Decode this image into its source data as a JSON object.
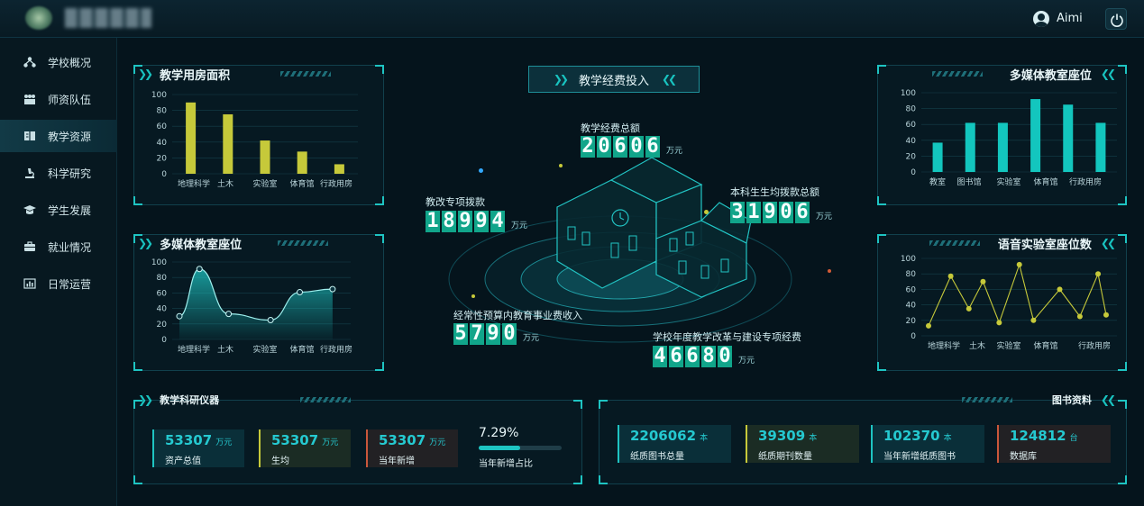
{
  "header": {
    "user_name": "Aimi"
  },
  "sidebar": {
    "items": [
      {
        "label": "学校概况",
        "icon": "network-icon"
      },
      {
        "label": "师资队伍",
        "icon": "people-icon"
      },
      {
        "label": "教学资源",
        "icon": "book-icon",
        "active": true
      },
      {
        "label": "科学研究",
        "icon": "microscope-icon"
      },
      {
        "label": "学生发展",
        "icon": "graduate-icon"
      },
      {
        "label": "就业情况",
        "icon": "briefcase-icon"
      },
      {
        "label": "日常运营",
        "icon": "bar-chart-icon"
      }
    ]
  },
  "colors": {
    "teal": "#1ec4c2",
    "yellow": "#c6c93a",
    "green": "#11a58a"
  },
  "chart_data": [
    {
      "type": "bar",
      "title": "教学用房面积",
      "categories": [
        "地理科学",
        "土木",
        "实验室",
        "体育馆",
        "行政用房"
      ],
      "values": [
        90,
        75,
        42,
        28,
        12
      ],
      "ylim": [
        0,
        100
      ],
      "yticks": [
        "0",
        "20",
        "40",
        "60",
        "80",
        "100"
      ],
      "color": "#c6c93a",
      "grid": true
    },
    {
      "type": "area",
      "title": "多媒体教室座位",
      "categories": [
        "地理科学",
        "土木",
        "实验室",
        "体育馆",
        "行政用房"
      ],
      "x": [
        0,
        0.55,
        1.35,
        2.5,
        3.3,
        4.2
      ],
      "values": [
        30,
        91,
        33,
        25,
        61,
        65
      ],
      "ylim": [
        0,
        100
      ],
      "yticks": [
        "0",
        "20",
        "40",
        "60",
        "80",
        "100"
      ],
      "color": "#1ec4c2",
      "grid": true
    },
    {
      "type": "bar",
      "title": "多媒体教室座位",
      "categories": [
        "教室",
        "图书馆",
        "实验室",
        "体育馆",
        "行政用房"
      ],
      "values": [
        37,
        62,
        62,
        92,
        85,
        62
      ],
      "ylim": [
        0,
        100
      ],
      "yticks": [
        "0",
        "20",
        "40",
        "60",
        "80",
        "100"
      ],
      "color": "#13c6be",
      "grid": true
    },
    {
      "type": "line",
      "title": "语音实验室座位数",
      "categories": [
        "地理科学",
        "土木",
        "实验室",
        "体育馆",
        "行政用房"
      ],
      "x": [
        0,
        0.55,
        1.0,
        1.35,
        1.75,
        2.25,
        2.6,
        3.25,
        3.75,
        4.2,
        4.4
      ],
      "values": [
        13,
        77,
        35,
        70,
        17,
        92,
        20,
        60,
        25,
        80,
        27
      ],
      "ylim": [
        0,
        100
      ],
      "yticks": [
        "0",
        "20",
        "40",
        "60",
        "80",
        "100"
      ],
      "color": "#c6c93a",
      "grid": true
    }
  ],
  "center": {
    "title": "教学经费投入",
    "stats": [
      {
        "label": "教学经费总额",
        "value": "20606",
        "unit": "万元"
      },
      {
        "label": "教改专项拨款",
        "value": "18994",
        "unit": "万元"
      },
      {
        "label": "本科生生均拨款总额",
        "value": "31906",
        "unit": "万元"
      },
      {
        "label": "经常性预算内教育事业费收入",
        "value": "5790",
        "unit": "万元"
      },
      {
        "label": "学校年度教学改革与建设专项经费",
        "value": "46680",
        "unit": "万元"
      }
    ]
  },
  "instruments": {
    "title": "教学科研仪器",
    "cards": [
      {
        "value": "53307",
        "unit": "万元",
        "label": "资产总值"
      },
      {
        "value": "53307",
        "unit": "万元",
        "label": "生均"
      },
      {
        "value": "53307",
        "unit": "万元",
        "label": "当年新增"
      }
    ],
    "ratio": {
      "value": "7.29%",
      "label": "当年新增占比",
      "fraction": 0.5
    }
  },
  "library": {
    "title": "图书资料",
    "cards": [
      {
        "value": "2206062",
        "unit": "本",
        "label": "纸质图书总量"
      },
      {
        "value": "39309",
        "unit": "本",
        "label": "纸质期刊数量"
      },
      {
        "value": "102370",
        "unit": "本",
        "label": "当年新增纸质图书"
      },
      {
        "value": "124812",
        "unit": "台",
        "label": "数据库"
      }
    ]
  }
}
